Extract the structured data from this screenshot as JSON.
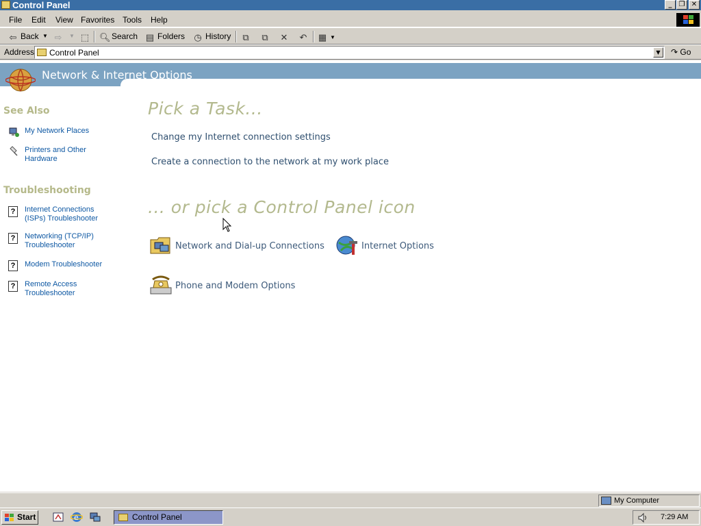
{
  "window": {
    "title": "Control Panel"
  },
  "menu": [
    "File",
    "Edit",
    "View",
    "Favorites",
    "Tools",
    "Help"
  ],
  "toolbar": {
    "back": "Back",
    "search": "Search",
    "folders": "Folders",
    "history": "History"
  },
  "address": {
    "label": "Address",
    "value": "Control Panel",
    "go": "Go"
  },
  "banner": {
    "title": "Network & Internet Options"
  },
  "sidebar": {
    "see_also": {
      "heading": "See Also",
      "items": [
        "My Network Places",
        "Printers and Other Hardware"
      ]
    },
    "troubleshooting": {
      "heading": "Troubleshooting",
      "items": [
        "Internet Connections (ISPs) Troubleshooter",
        "Networking (TCP/IP) Troubleshooter",
        "Modem Troubleshooter",
        "Remote Access Troubleshooter"
      ]
    }
  },
  "main": {
    "task_heading": "Pick a Task...",
    "tasks": [
      "Change my Internet connection settings",
      "Create a connection to the network at my work place"
    ],
    "icon_heading": "... or pick a Control Panel icon",
    "icons": [
      {
        "label": "Network and Dial-up Connections",
        "icon": "network-connections-icon"
      },
      {
        "label": "Internet Options",
        "icon": "internet-options-icon"
      },
      {
        "label": "Phone and Modem Options",
        "icon": "phone-modem-icon"
      }
    ]
  },
  "statusbar": {
    "zone": "My Computer"
  },
  "taskbar": {
    "start": "Start",
    "active_window": "Control Panel",
    "clock": "7:29 AM"
  },
  "colors": {
    "banner": "#7ca3c2",
    "heading": "#b3b98e",
    "link": "#0e58a3",
    "titlebar": "#3a6ea5"
  }
}
